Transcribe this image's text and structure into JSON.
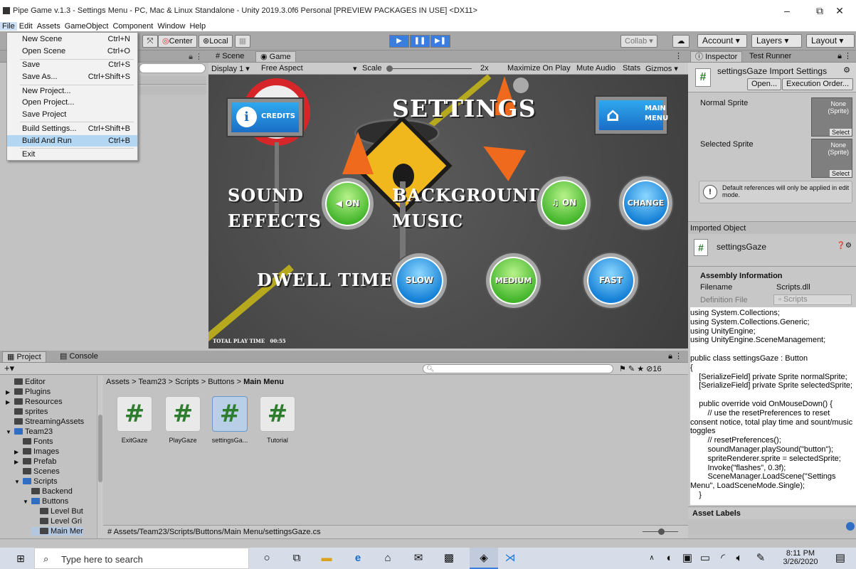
{
  "window": {
    "title": "Pipe Game v.1.3 - Settings Menu - PC, Mac & Linux Standalone - Unity 2019.3.0f6 Personal [PREVIEW PACKAGES IN USE] <DX11>",
    "minimize": "–",
    "maximize": "⧉",
    "close": "✕"
  },
  "menubar": [
    "File",
    "Edit",
    "Assets",
    "GameObject",
    "Component",
    "Window",
    "Help"
  ],
  "file_menu": [
    {
      "label": "New Scene",
      "shortcut": "Ctrl+N"
    },
    {
      "label": "Open Scene",
      "shortcut": "Ctrl+O"
    },
    {
      "label": "Save",
      "shortcut": "Ctrl+S"
    },
    {
      "label": "Save As...",
      "shortcut": "Ctrl+Shift+S"
    },
    {
      "label": "New Project...",
      "shortcut": ""
    },
    {
      "label": "Open Project...",
      "shortcut": ""
    },
    {
      "label": "Save Project",
      "shortcut": ""
    },
    {
      "label": "Build Settings...",
      "shortcut": "Ctrl+Shift+B"
    },
    {
      "label": "Build And Run",
      "shortcut": "Ctrl+B"
    },
    {
      "label": "Exit",
      "shortcut": ""
    }
  ],
  "toolbar": {
    "center": "Center",
    "local": "Local",
    "collab": "Collab ▾",
    "account": "Account",
    "layers": "Layers",
    "layout": "Layout"
  },
  "scene_tabs": {
    "scene": "Scene",
    "game": "Game",
    "display": "Display 1",
    "aspect": "Free Aspect",
    "scale_label": "Scale",
    "scale_value": "2x",
    "maximize": "Maximize On Play",
    "mute": "Mute Audio",
    "stats": "Stats",
    "gizmos": "Gizmos"
  },
  "game": {
    "title": "SETTINGS",
    "credits": "CREDITS",
    "main_menu_1": "MAIN",
    "main_menu_2": "MENU",
    "sound_1": "SOUND",
    "sound_2": "EFFECTS",
    "sound_btn": "ON",
    "bg_1": "BACKGROUND",
    "bg_2": "MUSIC",
    "music_btn": "ON",
    "change": "CHANGE",
    "dwell": "DWELL TIME",
    "slow": "SLOW",
    "medium": "MEDIUM",
    "fast": "FAST",
    "play_time_label": "TOTAL PLAY TIME",
    "play_time_value": "00:55"
  },
  "inspector": {
    "tab_inspector": "Inspector",
    "tab_test_runner": "Test Runner",
    "header": "settingsGaze Import Settings",
    "open": "Open...",
    "exec_order": "Execution Order...",
    "normal_sprite": "Normal Sprite",
    "selected_sprite": "Selected Sprite",
    "none_sprite": "None\n(Sprite)",
    "select": "Select",
    "warning": "Default references will only be applied in edit mode.",
    "imported_object": "Imported Object",
    "object_name": "settingsGaze",
    "assembly_info": "Assembly Information",
    "filename_label": "Filename",
    "filename_value": "Scripts.dll",
    "definition_label": "Definition File",
    "definition_value": "Scripts",
    "code": "using System.Collections;\nusing System.Collections.Generic;\nusing UnityEngine;\nusing UnityEngine.SceneManagement;\n\npublic class settingsGaze : Button\n{\n    [SerializeField] private Sprite normalSprite;\n    [SerializeField] private Sprite selectedSprite;\n\n    public override void OnMouseDown() {\n        // use the resetPreferences to reset consent notice, total play time and sount/music toggles\n        // resetPreferences();\n        soundManager.playSound(\"button\");\n        spriteRenderer.sprite = selectedSprite;\n        Invoke(\"flashes\", 0.3f);\n        SceneManager.LoadScene(\"Settings Menu\", LoadSceneMode.Single);\n    }",
    "asset_labels": "Asset Labels"
  },
  "project": {
    "tab_project": "Project",
    "tab_console": "Console",
    "hidden_count": "16",
    "tree": [
      {
        "label": "Editor",
        "indent": 1,
        "arrow": ""
      },
      {
        "label": "Plugins",
        "indent": 1,
        "arrow": "▶"
      },
      {
        "label": "Resources",
        "indent": 1,
        "arrow": "▶"
      },
      {
        "label": "sprites",
        "indent": 1,
        "arrow": ""
      },
      {
        "label": "StreamingAssets",
        "indent": 1,
        "arrow": ""
      },
      {
        "label": "Team23",
        "indent": 1,
        "arrow": "▼"
      },
      {
        "label": "Fonts",
        "indent": 2,
        "arrow": ""
      },
      {
        "label": "Images",
        "indent": 2,
        "arrow": "▶"
      },
      {
        "label": "Prefab",
        "indent": 2,
        "arrow": "▶"
      },
      {
        "label": "Scenes",
        "indent": 2,
        "arrow": ""
      },
      {
        "label": "Scripts",
        "indent": 2,
        "arrow": "▼"
      },
      {
        "label": "Backend",
        "indent": 3,
        "arrow": ""
      },
      {
        "label": "Buttons",
        "indent": 3,
        "arrow": "▼"
      },
      {
        "label": "Level But",
        "indent": 4,
        "arrow": ""
      },
      {
        "label": "Level Gri",
        "indent": 4,
        "arrow": ""
      },
      {
        "label": "Main Mer",
        "indent": 4,
        "arrow": ""
      }
    ],
    "breadcrumb": [
      "Assets",
      "Team23",
      "Scripts",
      "Buttons",
      "Main Menu"
    ],
    "assets": [
      "ExitGaze",
      "PlayGaze",
      "settingsGa...",
      "Tutorial"
    ],
    "path": "Assets/Team23/Scripts/Buttons/Main Menu/settingsGaze.cs"
  },
  "taskbar": {
    "search_placeholder": "Type here to search",
    "time": "8:11 PM",
    "date": "3/26/2020"
  },
  "colors": {
    "unity_bg": "#c2c2c2",
    "play_blue": "#3b7ddd",
    "selection": "#b3d7f3"
  }
}
